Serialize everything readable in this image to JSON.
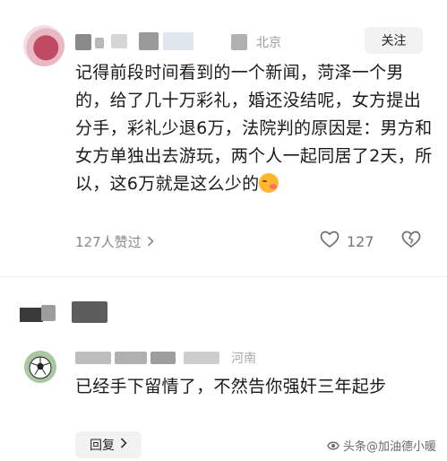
{
  "comment": {
    "location": "北京",
    "follow_label": "关注",
    "text": "记得前段时间看到的一个新闻，菏泽一个男的，给了几十万彩礼，婚还没结呢，女方提出分手，彩礼少退6万，法院判的原因是：男方和女方单独出去游玩，两个人一起同居了2天，所以，这6万就是这么少的",
    "likes_text": "127人赞过",
    "like_count": "127"
  },
  "reply": {
    "location": "河南",
    "text": "已经手下留情了，不然告你强奸三年起步",
    "reply_label": "回复"
  },
  "watermark": {
    "text": "头条@加油德小暖"
  },
  "icons": {
    "avatar1": "avatar-red-flower",
    "avatar2": "soccer-ball-avatar",
    "emoji": "kissing-face-emoji",
    "like": "heart-outline-icon",
    "dislike": "broken-heart-icon",
    "chevron": "chevron-right-icon"
  }
}
